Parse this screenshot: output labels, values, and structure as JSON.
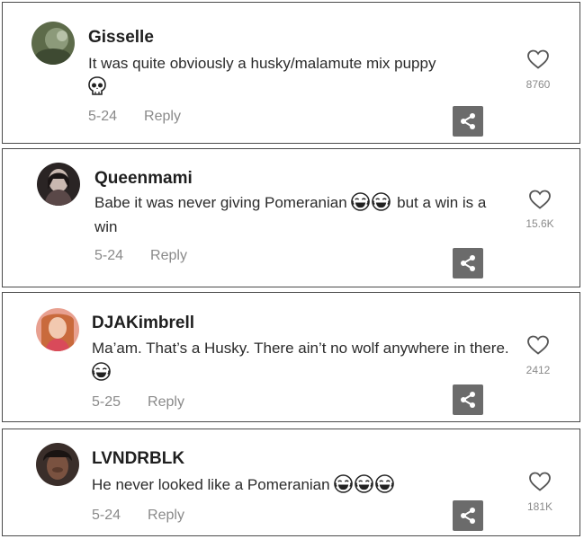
{
  "comments": [
    {
      "username": "Gisselle",
      "text_before": "It was quite obviously a husky/malamute mix puppy",
      "text_after": "",
      "emojis": [
        "skull-emoji"
      ],
      "date": "5-24",
      "reply_label": "Reply",
      "likes": "8760"
    },
    {
      "username": "Queenmami",
      "text_before": "Babe it was never giving Pomeranian",
      "text_after": "but a win is a win",
      "emojis": [
        "laughing-emoji",
        "laughing-emoji"
      ],
      "date": "5-24",
      "reply_label": "Reply",
      "likes": "15.6K"
    },
    {
      "username": "DJAKimbrell",
      "text_before": "Ma’am. That’s a Husky. There ain’t no wolf anywhere in there.",
      "text_after": "",
      "emojis": [
        "laughing-emoji"
      ],
      "date": "5-25",
      "reply_label": "Reply",
      "likes": "2412"
    },
    {
      "username": "LVNDRBLK",
      "text_before": "He never looked like a Pomeranian",
      "text_after": "",
      "emojis": [
        "laughing-emoji",
        "laughing-emoji",
        "laughing-emoji"
      ],
      "date": "5-24",
      "reply_label": "Reply",
      "likes": "181K"
    }
  ]
}
